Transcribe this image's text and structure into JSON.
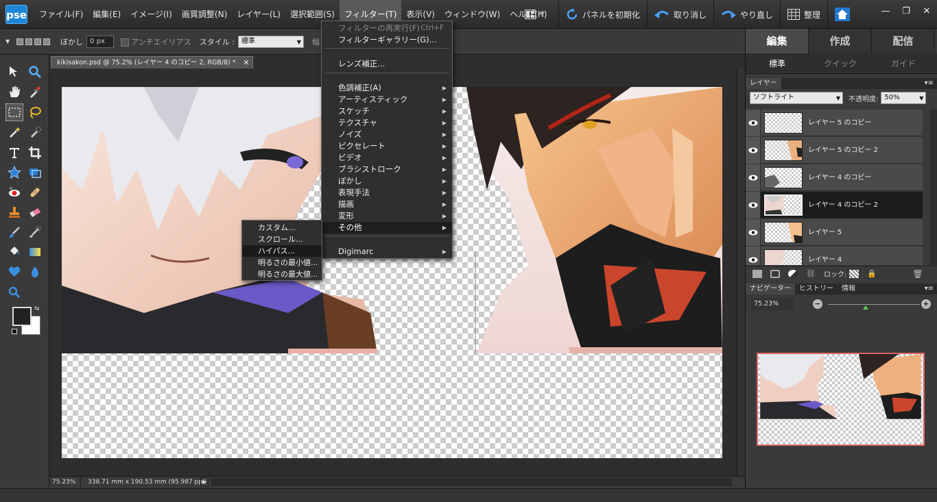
{
  "app": {
    "logo_text": "pse"
  },
  "menubar": {
    "items": [
      "ファイル(F)",
      "編集(E)",
      "イメージ(I)",
      "画質調整(N)",
      "レイヤー(L)",
      "選択範囲(S)",
      "フィルター(T)",
      "表示(V)",
      "ウィンドウ(W)",
      "ヘルプ(H)"
    ],
    "active": "フィルター(T)"
  },
  "top_tools": {
    "reset_panels": "パネルを初期化",
    "undo": "取り消し",
    "redo": "やり直し",
    "organize": "整理"
  },
  "options_bar": {
    "feather_label": "ぼかし",
    "feather_value": "0 px",
    "antialias_label": "アンチエイリアス",
    "style_label": "スタイル :",
    "style_value": "標準",
    "width_label": "幅"
  },
  "document": {
    "tab_title": "kikisakon.psd @ 75.2% (レイヤー 4 のコピー 2, RGB/8) *",
    "close_glyph": "✕",
    "status_zoom": "75.23%",
    "status_size": "338.71 mm x 190.53 mm (95.987 ppi)"
  },
  "filter_menu": {
    "items": [
      {
        "label": "フィルターの再実行(F)",
        "shortcut": "Ctrl+F",
        "disabled": true
      },
      {
        "label": "フィルターギャラリー(G)..."
      },
      {
        "label": "レンズ補正..."
      },
      {
        "label": "色調補正(A)"
      },
      {
        "label": "アーティスティック"
      },
      {
        "label": "スケッチ"
      },
      {
        "label": "テクスチャ"
      },
      {
        "label": "ノイズ"
      },
      {
        "label": "ピクセレート"
      },
      {
        "label": "ビデオ"
      },
      {
        "label": "ブラシストローク"
      },
      {
        "label": "ぼかし"
      },
      {
        "label": "表現手法"
      },
      {
        "label": "描画"
      },
      {
        "label": "変形"
      },
      {
        "label": "その他",
        "highlighted": true
      },
      {
        "label": "Digimarc"
      }
    ],
    "submenu_glyph": "▶"
  },
  "other_submenu": {
    "items": [
      "カスタム...",
      "スクロール...",
      "ハイパス...",
      "明るさの最小値...",
      "明るさの最大値..."
    ],
    "highlighted": "ハイパス..."
  },
  "right_panel": {
    "mode_tabs": [
      "編集",
      "作成",
      "配信"
    ],
    "active_mode": "編集",
    "sub_tabs": [
      "標準",
      "クイック",
      "ガイド"
    ],
    "active_sub": "標準",
    "layers_panel": {
      "title": "レイヤー",
      "blend_mode": "ソフトライト",
      "opacity_label": "不透明度:",
      "opacity_value": "50%",
      "lock_label": "ロック:",
      "layers": [
        {
          "name": "レイヤー 5 のコピー",
          "selected": false
        },
        {
          "name": "レイヤー 5 のコピー 2",
          "selected": false
        },
        {
          "name": "レイヤー 4 のコピー",
          "selected": false
        },
        {
          "name": "レイヤー 4 のコピー 2",
          "selected": true
        },
        {
          "name": "レイヤー 5",
          "selected": false
        },
        {
          "name": "レイヤー 4",
          "selected": false
        }
      ]
    },
    "navigator": {
      "tabs": [
        "ナビゲーター",
        "ヒストリー",
        "情報"
      ],
      "zoom": "75.23%",
      "zoom_position": 0.41
    }
  },
  "colors": {
    "accent_blue": "#1c86d8",
    "foreground": "#222222",
    "background": "#ffffff",
    "nav_frame": "#dd6666"
  }
}
